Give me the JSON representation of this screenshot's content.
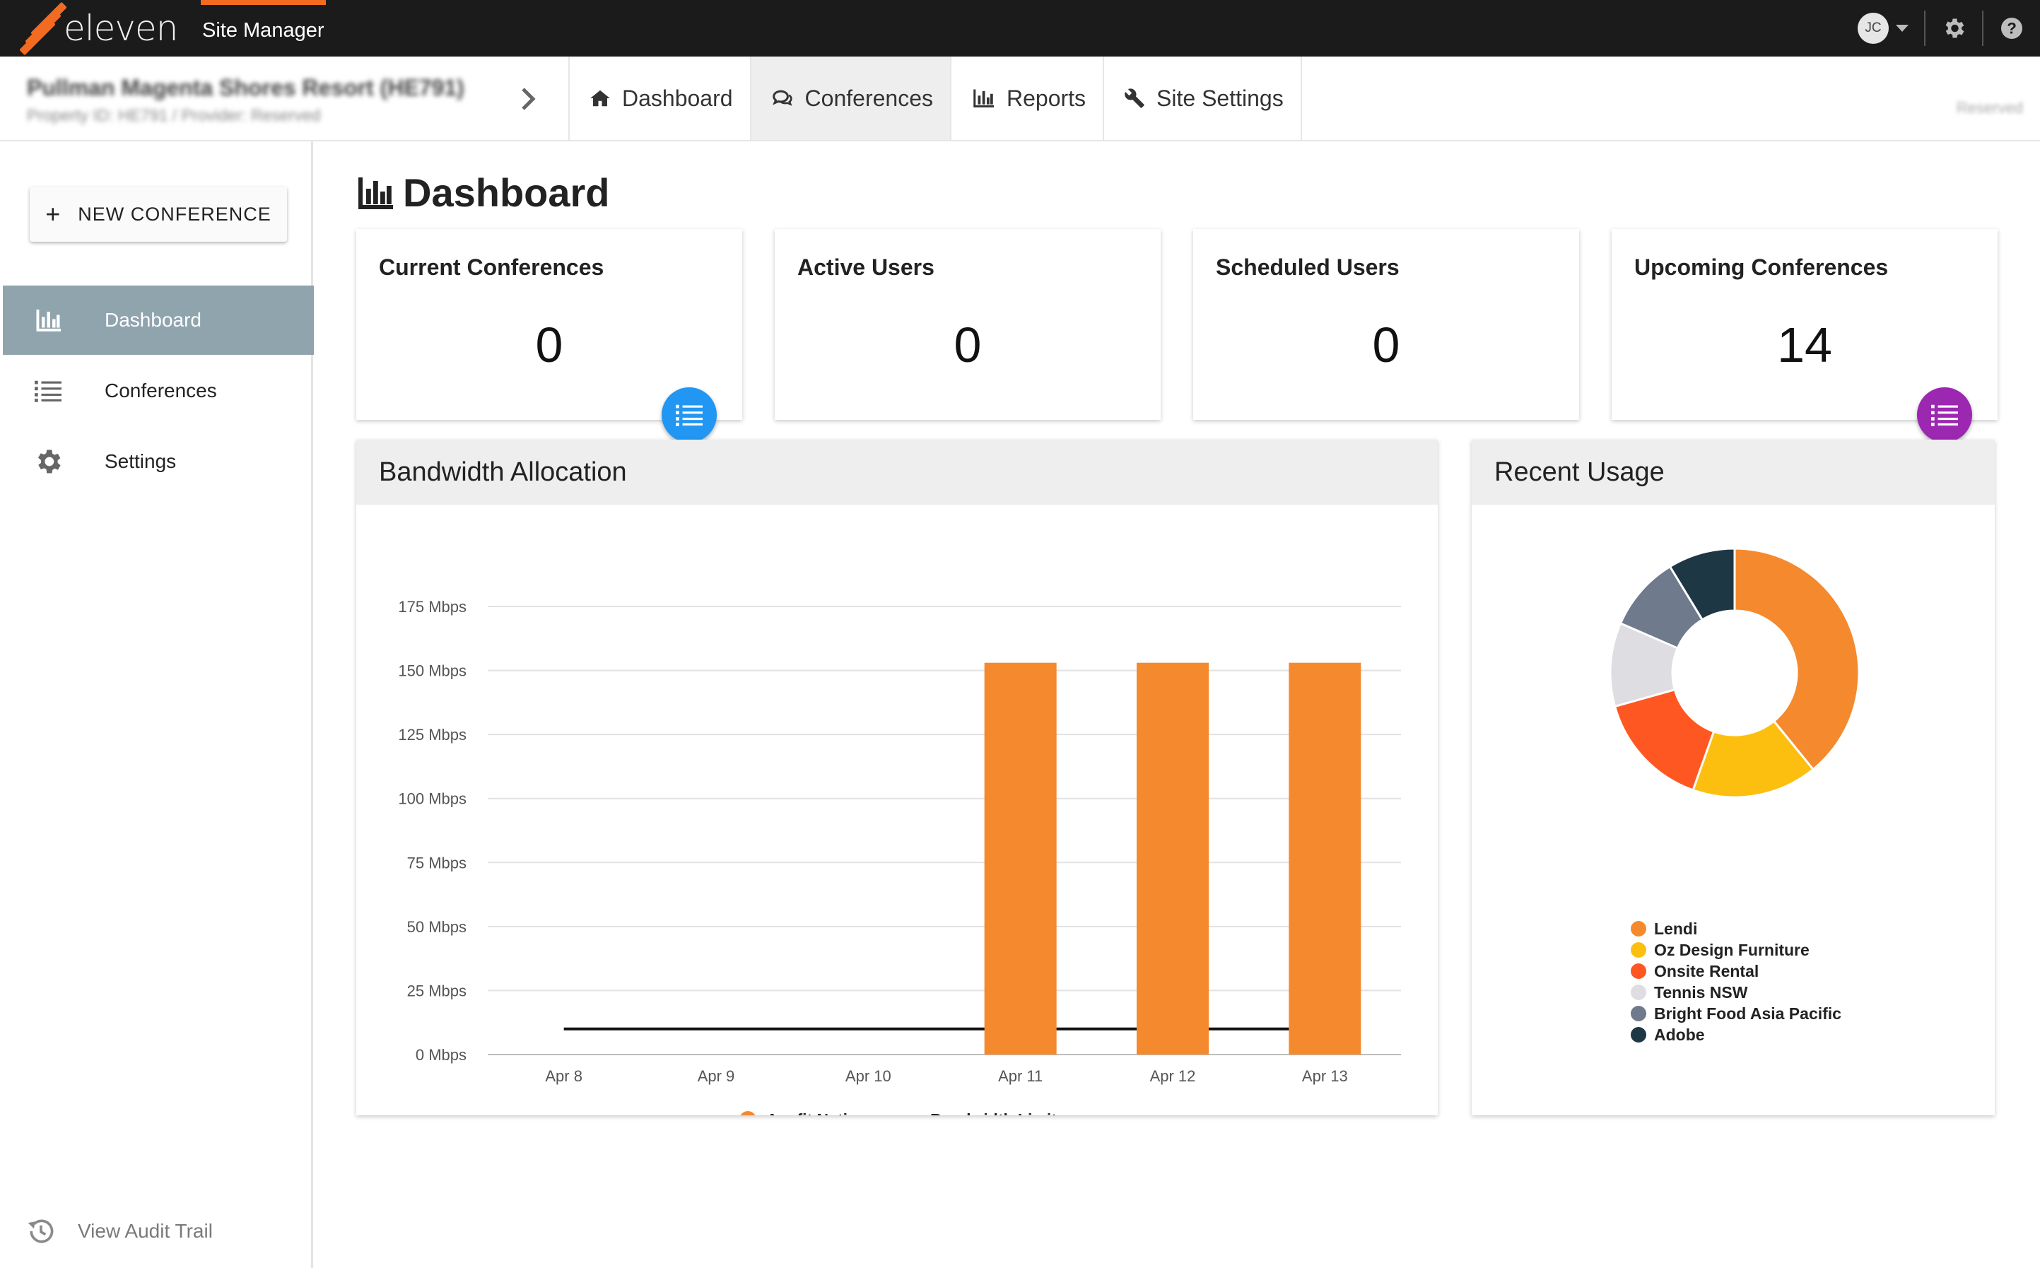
{
  "topbar": {
    "logo_text": "eleven",
    "app_name": "Site Manager",
    "user_initials": "JC"
  },
  "site": {
    "name": "Pullman Magenta Shores Resort (HE791)",
    "sub": "Property ID: HE791 / Provider: Reserved",
    "right_text": "Reserved"
  },
  "nav": {
    "tabs": [
      {
        "label": "Dashboard",
        "icon": "home-icon"
      },
      {
        "label": "Conferences",
        "icon": "chat-icon"
      },
      {
        "label": "Reports",
        "icon": "bar-chart-icon"
      },
      {
        "label": "Site Settings",
        "icon": "wrench-icon"
      }
    ]
  },
  "sidebar": {
    "new_button": "NEW CONFERENCE",
    "items": [
      {
        "label": "Dashboard",
        "icon": "bar-chart-icon"
      },
      {
        "label": "Conferences",
        "icon": "list-icon"
      },
      {
        "label": "Settings",
        "icon": "gear-icon"
      }
    ],
    "audit_label": "View Audit Trail"
  },
  "main": {
    "title": "Dashboard",
    "stats": [
      {
        "title": "Current Conferences",
        "value": "0"
      },
      {
        "title": "Active Users",
        "value": "0"
      },
      {
        "title": "Scheduled Users",
        "value": "0"
      },
      {
        "title": "Upcoming Conferences",
        "value": "14"
      }
    ],
    "bandwidth_title": "Bandwidth Allocation",
    "usage_title": "Recent Usage"
  },
  "colors": {
    "brand": "#f26b21",
    "fab_blue": "#2196f3",
    "fab_purple": "#9c27b0",
    "sidebar_active": "#90a4ae"
  },
  "chart_data": [
    {
      "type": "bar",
      "title": "Bandwidth Allocation",
      "categories": [
        "Apr 8",
        "Apr 9",
        "Apr 10",
        "Apr 11",
        "Apr 12",
        "Apr 13"
      ],
      "series": [
        {
          "name": "Ausfit Nation",
          "type": "bar",
          "color": "#f5892e",
          "values": [
            0,
            0,
            0,
            153,
            153,
            153
          ]
        },
        {
          "name": "Bandwidth Limit",
          "type": "line",
          "color": "#111111",
          "values": [
            10,
            10,
            10,
            10,
            10,
            10
          ]
        }
      ],
      "y_ticks": [
        "0 Mbps",
        "25 Mbps",
        "50 Mbps",
        "75 Mbps",
        "100 Mbps",
        "125 Mbps",
        "150 Mbps",
        "175 Mbps"
      ],
      "ylim": [
        0,
        175
      ],
      "grid": true,
      "legend": "bottom"
    },
    {
      "type": "pie",
      "title": "Recent Usage",
      "donut": true,
      "slices": [
        {
          "label": "Lendi",
          "value": 36,
          "color": "#f5892e"
        },
        {
          "label": "Oz Design Furniture",
          "value": 15,
          "color": "#fdbf0f"
        },
        {
          "label": "Onsite Rental",
          "value": 14,
          "color": "#ff5722"
        },
        {
          "label": "Tennis NSW",
          "value": 10,
          "color": "#dddde2"
        },
        {
          "label": "Bright Food Asia Pacific",
          "value": 9,
          "color": "#6f7b8c"
        },
        {
          "label": "Adobe",
          "value": 8,
          "color": "#1e3745"
        }
      ],
      "legend": "bottom"
    }
  ]
}
